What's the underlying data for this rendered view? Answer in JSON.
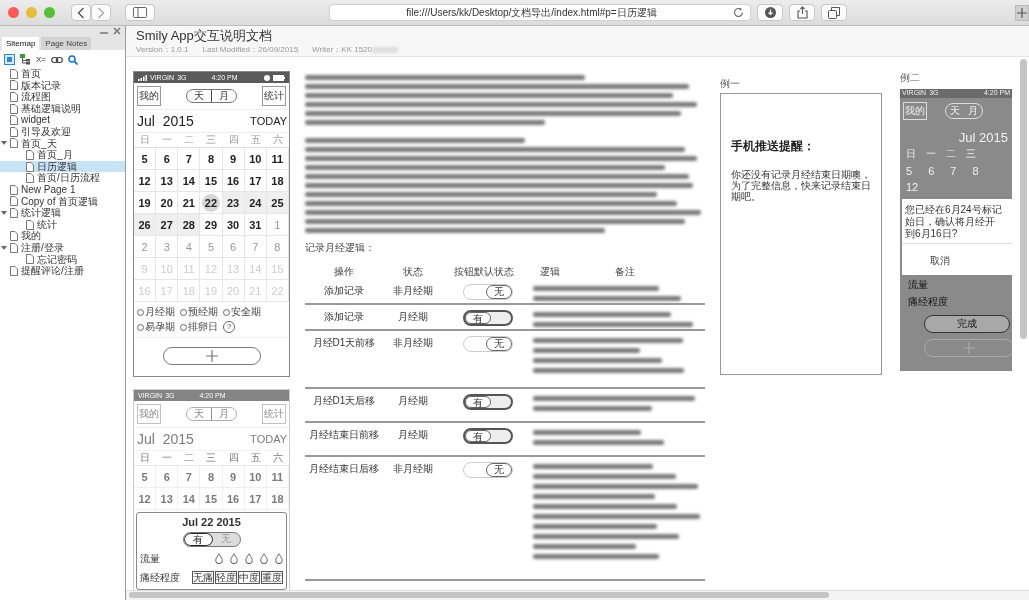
{
  "browser": {
    "url": "file:///Users/kk/Desktop/文档导出/index.html#p=日历逻辑"
  },
  "sidebar": {
    "tabs": [
      {
        "label": "Sitemap",
        "selected": true
      },
      {
        "label": "Page Notes",
        "selected": false
      }
    ],
    "variables_button": "X=",
    "items": [
      {
        "label": "首页",
        "selected": false
      },
      {
        "label": "版本记录",
        "selected": false
      },
      {
        "label": "流程图",
        "selected": false
      },
      {
        "label": "基础逻辑说明",
        "selected": false
      },
      {
        "label": "widget",
        "selected": false
      },
      {
        "label": "引导及欢迎",
        "selected": false
      },
      {
        "label": "首页_天",
        "selected": false,
        "expanded": true,
        "children": [
          {
            "label": "首页_月",
            "selected": false
          },
          {
            "label": "日历逻辑",
            "selected": true
          },
          {
            "label": "首页/日历流程",
            "selected": false
          }
        ]
      },
      {
        "label": "New Page 1",
        "selected": false
      },
      {
        "label": "Copy of 首页逻辑",
        "selected": false
      },
      {
        "label": "统计逻辑",
        "selected": false,
        "expanded": true,
        "children": [
          {
            "label": "统计",
            "selected": false
          }
        ]
      },
      {
        "label": "我的",
        "selected": false
      },
      {
        "label": "注册/登录",
        "selected": false,
        "expanded": true,
        "children": [
          {
            "label": "忘记密码",
            "selected": false
          }
        ]
      },
      {
        "label": "提醒评论/注册",
        "selected": false
      }
    ]
  },
  "document": {
    "title": "Smily App交互说明文档",
    "version": "Version：1.0.1",
    "modified": "Last Modified：26/09/2015",
    "writer": "Writer：KK 1520"
  },
  "phone": {
    "carrier": "VIRGIN",
    "network": "3G",
    "time": "4:20 PM",
    "left_button": "我的",
    "right_button": "统计",
    "segments": [
      "天",
      "月"
    ],
    "month": "Jul  2015",
    "today_button": "TODAY",
    "weekdays": [
      "日",
      "一",
      "二",
      "三",
      "四",
      "五",
      "六"
    ],
    "weeks": [
      [
        {
          "label": "5",
          "kind": "current",
          "marked": false,
          "today": false
        },
        {
          "label": "6",
          "kind": "current",
          "marked": false,
          "today": false
        },
        {
          "label": "7",
          "kind": "current",
          "marked": false,
          "today": false
        },
        {
          "label": "8",
          "kind": "current",
          "marked": false,
          "today": false
        },
        {
          "label": "9",
          "kind": "current",
          "marked": false,
          "today": false
        },
        {
          "label": "10",
          "kind": "current",
          "marked": false,
          "today": false
        },
        {
          "label": "11",
          "kind": "current",
          "marked": false,
          "today": false
        }
      ],
      [
        {
          "label": "12",
          "kind": "current",
          "marked": false,
          "today": false
        },
        {
          "label": "13",
          "kind": "current",
          "marked": false,
          "today": false
        },
        {
          "label": "14",
          "kind": "current",
          "marked": false,
          "today": false
        },
        {
          "label": "15",
          "kind": "current",
          "marked": false,
          "today": false
        },
        {
          "label": "16",
          "kind": "current",
          "marked": false,
          "today": false
        },
        {
          "label": "17",
          "kind": "current",
          "marked": false,
          "today": false
        },
        {
          "label": "18",
          "kind": "current",
          "marked": false,
          "today": false
        }
      ],
      [
        {
          "label": "19",
          "kind": "current",
          "marked": false,
          "today": false
        },
        {
          "label": "20",
          "kind": "current",
          "marked": false,
          "today": false
        },
        {
          "label": "21",
          "kind": "current",
          "marked": false,
          "today": false
        },
        {
          "label": "22",
          "kind": "current",
          "marked": false,
          "today": true
        },
        {
          "label": "23",
          "kind": "current",
          "marked": true,
          "today": false
        },
        {
          "label": "24",
          "kind": "current",
          "marked": true,
          "today": false
        },
        {
          "label": "25",
          "kind": "current",
          "marked": true,
          "today": false
        }
      ],
      [
        {
          "label": "26",
          "kind": "current",
          "marked": true,
          "today": false
        },
        {
          "label": "27",
          "kind": "current",
          "marked": true,
          "today": false
        },
        {
          "label": "28",
          "kind": "current",
          "marked": true,
          "today": false
        },
        {
          "label": "29",
          "kind": "current",
          "marked": false,
          "today": false
        },
        {
          "label": "30",
          "kind": "current",
          "marked": false,
          "today": false
        },
        {
          "label": "31",
          "kind": "current",
          "marked": false,
          "today": false
        },
        {
          "label": "1",
          "kind": "next",
          "marked": false,
          "today": false
        }
      ],
      [
        {
          "label": "2",
          "kind": "next",
          "marked": false,
          "today": false
        },
        {
          "label": "3",
          "kind": "next",
          "marked": false,
          "today": false
        },
        {
          "label": "4",
          "kind": "next",
          "marked": false,
          "today": false
        },
        {
          "label": "5",
          "kind": "next",
          "marked": false,
          "today": false
        },
        {
          "label": "6",
          "kind": "next",
          "marked": false,
          "today": false
        },
        {
          "label": "7",
          "kind": "next",
          "marked": false,
          "today": false
        },
        {
          "label": "8",
          "kind": "next",
          "marked": false,
          "today": false
        }
      ],
      [
        {
          "label": "9",
          "kind": "later",
          "marked": false,
          "today": false
        },
        {
          "label": "10",
          "kind": "later",
          "marked": false,
          "today": false
        },
        {
          "label": "11",
          "kind": "later",
          "marked": false,
          "today": false
        },
        {
          "label": "12",
          "kind": "later",
          "marked": false,
          "today": false
        },
        {
          "label": "13",
          "kind": "later",
          "marked": false,
          "today": false
        },
        {
          "label": "14",
          "kind": "later",
          "marked": false,
          "today": false
        },
        {
          "label": "15",
          "kind": "later",
          "marked": false,
          "today": false
        }
      ],
      [
        {
          "label": "16",
          "kind": "later",
          "marked": false,
          "today": false
        },
        {
          "label": "17",
          "kind": "later",
          "marked": false,
          "today": false
        },
        {
          "label": "18",
          "kind": "later",
          "marked": false,
          "today": false
        },
        {
          "label": "19",
          "kind": "later",
          "marked": false,
          "today": false
        },
        {
          "label": "20",
          "kind": "later",
          "marked": false,
          "today": false
        },
        {
          "label": "21",
          "kind": "later",
          "marked": false,
          "today": false
        },
        {
          "label": "22",
          "kind": "later",
          "marked": false,
          "today": false
        }
      ]
    ],
    "legend": [
      "月经期",
      "预经期",
      "安全期",
      "易孕期",
      "排卵日"
    ],
    "help": "?"
  },
  "phone_popup": {
    "carrier": "VIRGIN",
    "network": "3G",
    "time": "4:20 PM",
    "left_button": "我的",
    "right_button": "统计",
    "segments": [
      "天",
      "月"
    ],
    "month": "Jul  2015",
    "today_button": "TODAY",
    "weekdays": [
      "日",
      "一",
      "二",
      "三",
      "四",
      "五",
      "六"
    ],
    "weeks": [
      [
        "5",
        "6",
        "7",
        "8",
        "9",
        "10",
        "11"
      ],
      [
        "12",
        "13",
        "14",
        "15",
        "16",
        "17",
        "18"
      ]
    ],
    "popup": {
      "date": "Jul 22 2015",
      "toggle": [
        {
          "label": "有",
          "selected": true
        },
        {
          "label": "无",
          "selected": false
        }
      ],
      "flow_label": "流量",
      "pain_label": "痛经程度",
      "pain_options": [
        "无痛",
        "轻度",
        "中度",
        "重度"
      ]
    }
  },
  "logic": {
    "caption": "记录月经逻辑：",
    "columns": [
      "操作",
      "状态",
      "按钮默认状态",
      "逻辑",
      "备注"
    ],
    "rows": [
      {
        "action": "添加记录",
        "state": "非月经期",
        "toggle": {
          "label": "无",
          "on": false
        }
      },
      {
        "action": "添加记录",
        "state": "月经期",
        "toggle": {
          "label": "有",
          "on": true
        }
      },
      {
        "action": "月经D1天前移",
        "state": "非月经期",
        "toggle": {
          "label": "无",
          "on": false
        }
      },
      {
        "action": "月经D1天后移",
        "state": "月经期",
        "toggle": {
          "label": "有",
          "on": true
        }
      },
      {
        "action": "月经结束日前移",
        "state": "月经期",
        "toggle": {
          "label": "有",
          "on": true
        }
      },
      {
        "action": "月经结束日后移",
        "state": "非月经期",
        "toggle": {
          "label": "无",
          "on": false
        }
      }
    ]
  },
  "example_1": {
    "label": "例一",
    "title": "手机推送提醒：",
    "body": "你还没有记录月经结束日期噢，为了完整信息，快来记录结束日期吧。"
  },
  "example_2": {
    "label": "例二",
    "carrier": "VIRGIN",
    "network": "3G",
    "time": "4:20 PM",
    "left_button": "我的",
    "segments": [
      "天",
      "月"
    ],
    "month": "Jul 2015",
    "weekdays": [
      "日",
      "一",
      "二",
      "三"
    ],
    "days": [
      "5",
      "6",
      "7",
      "8"
    ],
    "next_day": "12",
    "dialog": {
      "lines": [
        "您已经在6月24号标记",
        "始日，确认将月经开",
        "到6月16日?"
      ],
      "cancel": "取消"
    },
    "flow_label": "流量",
    "pain_label": "痛经程度",
    "done": "完成"
  }
}
